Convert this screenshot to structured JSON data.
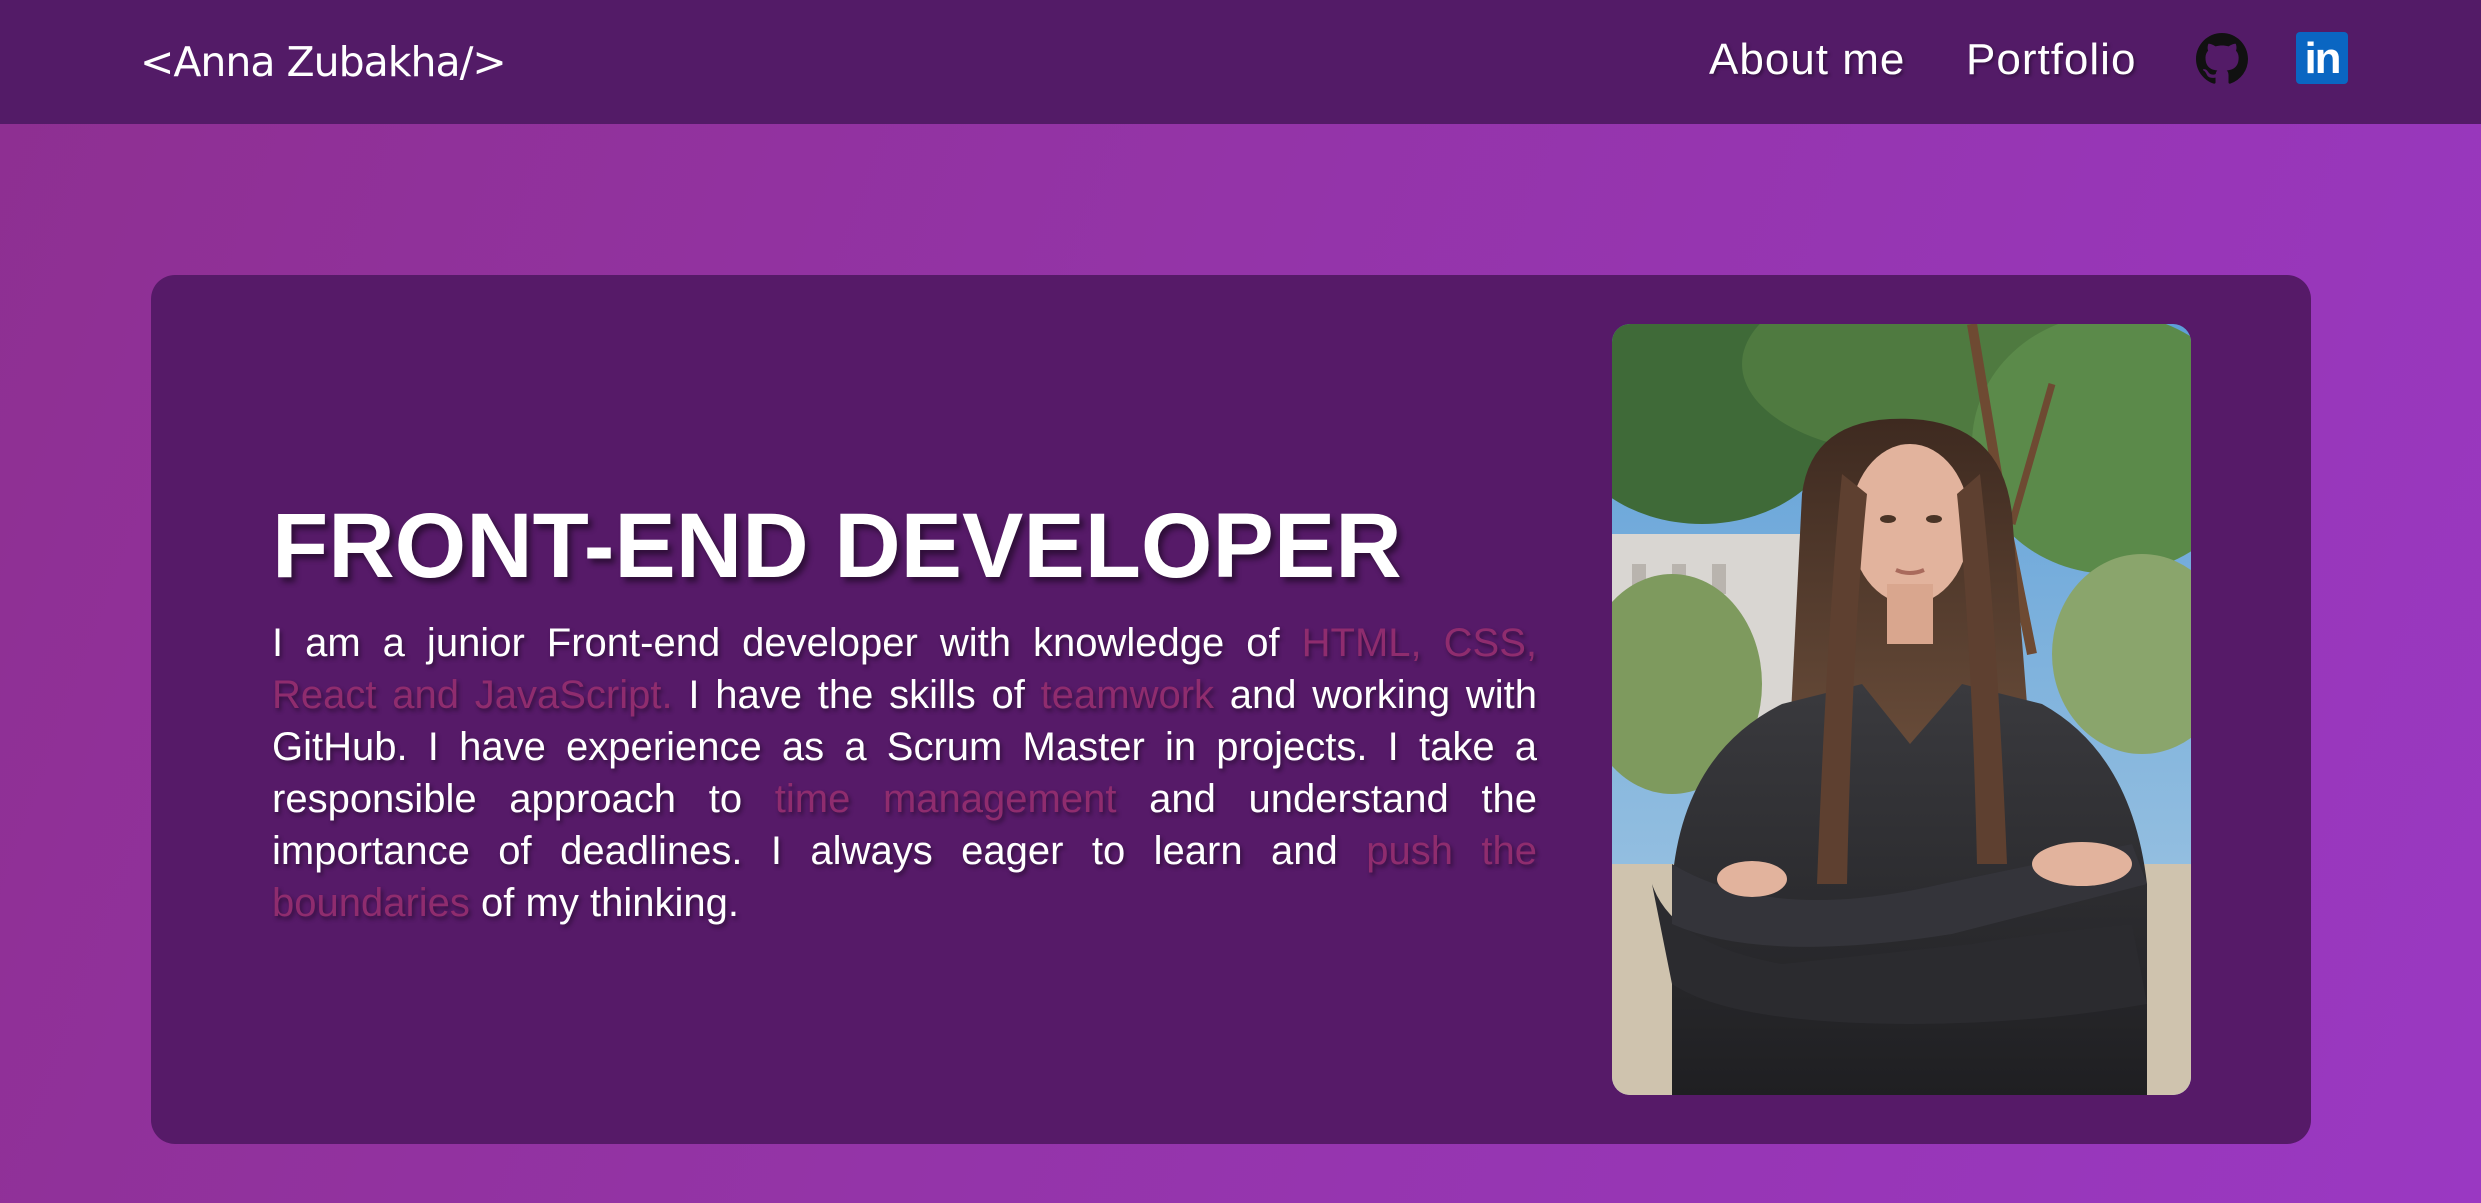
{
  "header": {
    "logo": "<Anna Zubakha/>",
    "nav": {
      "about_label": "About me",
      "portfolio_label": "Portfolio"
    },
    "icons": [
      "github-icon",
      "linkedin-icon"
    ],
    "linkedin_glyph": "in"
  },
  "hero": {
    "title": "FRONT-END DEVELOPER",
    "text": {
      "p1": "I am a junior Front-end developer with knowledge of ",
      "h1": "HTML, CSS, React and JavaScript.",
      "p2": " I have the skills of ",
      "h2": "teamwork",
      "p3": " and working with GitHub. I have experience as a Scrum Master in projects. I take a responsible approach to ",
      "h3": "time management",
      "p4": " and understand the importance of deadlines. I always eager to learn and ",
      "h4": "push the boundaries",
      "p5": " of my thinking."
    }
  },
  "colors": {
    "navbar": "#531b67",
    "card": "#561a68",
    "highlight": "#8f2c6e",
    "background_start": "#8e2f91",
    "background_end": "#9a38c2"
  }
}
